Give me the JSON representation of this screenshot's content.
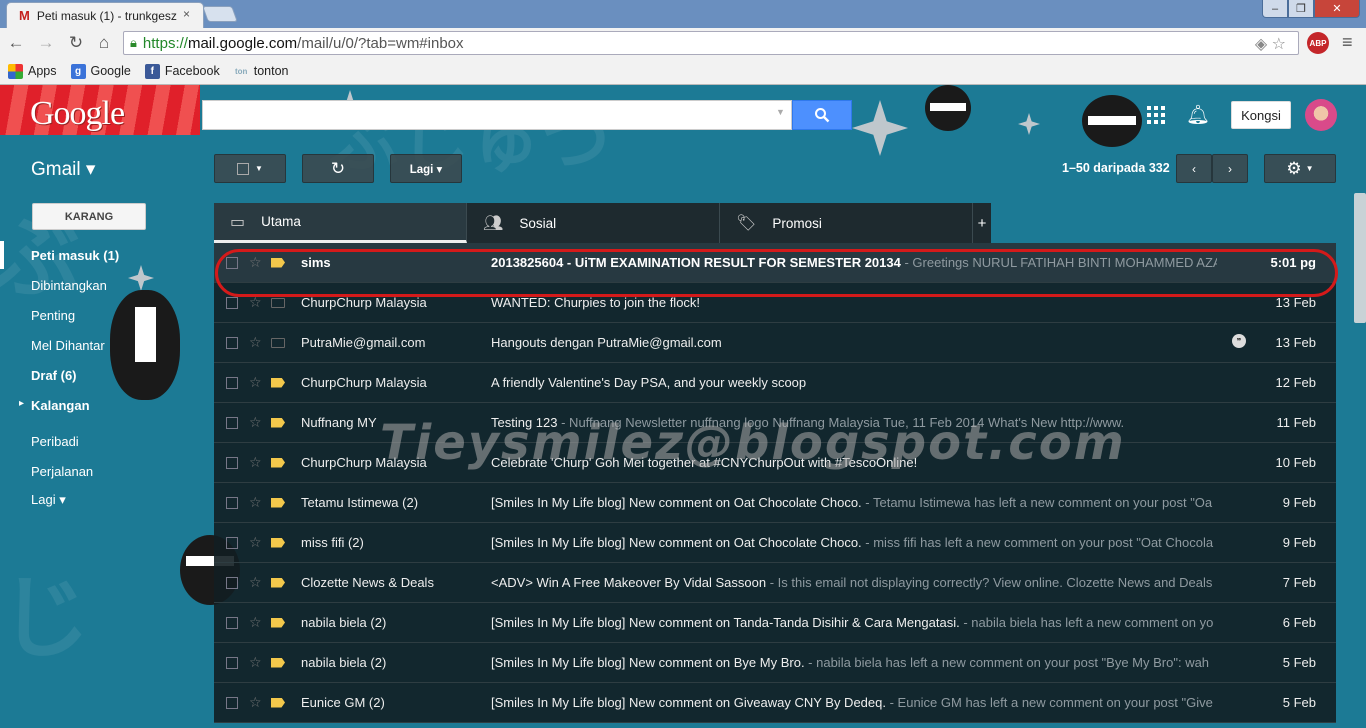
{
  "browser": {
    "tab_title": "Peti masuk (1) - trunkgesz",
    "tab_close": "×",
    "tab_icon": "gmail-m-icon",
    "window_min": "–",
    "window_max": "❐",
    "window_close": "✕",
    "url_scheme": "https://",
    "url_host": "mail.google.com",
    "url_path": "/mail/u/0/?tab=wm#inbox",
    "abp_label": "ABP",
    "bookmarks": [
      {
        "label": "Apps",
        "icon": "apps-grid-icon"
      },
      {
        "label": "Google",
        "icon": "google-g-icon"
      },
      {
        "label": "Facebook",
        "icon": "facebook-icon"
      },
      {
        "label": "tonton",
        "icon": "tonton-icon"
      }
    ]
  },
  "header": {
    "logo": "Google",
    "search_placeholder": "",
    "share_label": "Kongsi",
    "brand_red": "#e0202a",
    "search_blue": "#4d90fe"
  },
  "gmail": {
    "product_label": "Gmail ▾",
    "compose_label": "KARANG",
    "toolbar": {
      "more_label": "Lagi ▾",
      "pager": "1–50 daripada 332"
    },
    "nav": [
      {
        "label": "Peti masuk (1)",
        "bold": true,
        "active": true
      },
      {
        "label": "Dibintangkan",
        "bold": false
      },
      {
        "label": "Penting",
        "bold": false
      },
      {
        "label": "Mel Dihantar",
        "bold": false
      },
      {
        "label": "Draf (6)",
        "bold": true
      },
      {
        "label": "Kalangan",
        "bold": true,
        "expander": "▸"
      },
      {
        "label": "Peribadi",
        "bold": false
      },
      {
        "label": "Perjalanan",
        "bold": false
      },
      {
        "label": "Lagi ▾",
        "bold": false
      }
    ],
    "tabs": [
      {
        "label": "Utama",
        "icon": "inbox-tray-icon",
        "active": true
      },
      {
        "label": "Sosial",
        "icon": "people-icon",
        "active": false
      },
      {
        "label": "Promosi",
        "icon": "tag-icon",
        "active": false
      }
    ],
    "tab_add": "+",
    "watermark": "Tieysmilez@blogspot.com",
    "emails": [
      {
        "sender": "sims",
        "subject": "2013825604 - UiTM EXAMINATION RESULT FOR SEMESTER 20134",
        "snippet": " - Greetings NURUL FATIHAH BINTI MOHAMMED AZA",
        "date": "5:01 pg",
        "unread": true,
        "important": true
      },
      {
        "sender": "ChurpChurp Malaysia",
        "subject": "WANTED: Churpies to join the flock!",
        "snippet": "",
        "date": "13 Feb",
        "unread": false,
        "important": false
      },
      {
        "sender": "PutraMie@gmail.com",
        "subject": "Hangouts dengan PutraMie@gmail.com",
        "snippet": "",
        "date": "13 Feb",
        "unread": false,
        "important": false,
        "chat": true
      },
      {
        "sender": "ChurpChurp Malaysia",
        "subject": "A friendly Valentine's Day PSA, and your weekly scoop",
        "snippet": "",
        "date": "12 Feb",
        "unread": false,
        "important": true
      },
      {
        "sender": "Nuffnang MY",
        "subject": "Testing 123",
        "snippet": " - Nuffnang Newsletter nuffnang logo Nuffnang Malaysia Tue, 11 Feb 2014 What's New http://www.",
        "date": "11 Feb",
        "unread": false,
        "important": true
      },
      {
        "sender": "ChurpChurp Malaysia",
        "subject": "Celebrate 'Churp' Goh Mei together at #CNYChurpOut with #TescoOnline!",
        "snippet": "",
        "date": "10 Feb",
        "unread": false,
        "important": true
      },
      {
        "sender": "Tetamu Istimewa (2)",
        "subject": "[Smiles In My Life blog] New comment on Oat Chocolate Choco.",
        "snippet": " - Tetamu Istimewa has left a new comment on your post \"Oa",
        "date": "9 Feb",
        "unread": false,
        "important": true
      },
      {
        "sender": "miss fifi (2)",
        "subject": "[Smiles In My Life blog] New comment on Oat Chocolate Choco.",
        "snippet": " - miss fifi has left a new comment on your post \"Oat Chocola",
        "date": "9 Feb",
        "unread": false,
        "important": true
      },
      {
        "sender": "Clozette News & Deals",
        "subject": "<ADV> Win A Free Makeover By Vidal Sassoon",
        "snippet": " - Is this email not displaying correctly? View online. Clozette News and Deals",
        "date": "7 Feb",
        "unread": false,
        "important": true
      },
      {
        "sender": "nabila biela (2)",
        "subject": "[Smiles In My Life blog] New comment on Tanda-Tanda Disihir & Cara Mengatasi.",
        "snippet": " - nabila biela has left a new comment on yo",
        "date": "6 Feb",
        "unread": false,
        "important": true
      },
      {
        "sender": "nabila biela (2)",
        "subject": "[Smiles In My Life blog] New comment on Bye My Bro.",
        "snippet": " - nabila biela has left a new comment on your post \"Bye My Bro\": wah",
        "date": "5 Feb",
        "unread": false,
        "important": true
      },
      {
        "sender": "Eunice GM (2)",
        "subject": "[Smiles In My Life blog] New comment on Giveaway CNY By Dedeq.",
        "snippet": " - Eunice GM has left a new comment on your post \"Give",
        "date": "5 Feb",
        "unread": false,
        "important": true
      }
    ]
  }
}
